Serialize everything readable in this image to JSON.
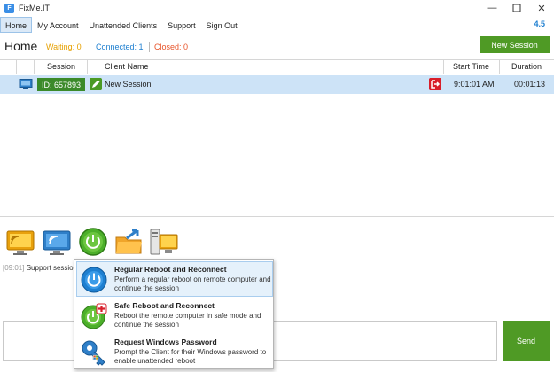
{
  "window": {
    "title": "FixMe.IT",
    "icon": "fixme-logo-icon",
    "controls": [
      "minimize-icon",
      "maximize-icon",
      "close-icon"
    ]
  },
  "menu": {
    "items": [
      "Home",
      "My Account",
      "Unattended Clients",
      "Support",
      "Sign Out"
    ],
    "active": "Home",
    "version": "4.5"
  },
  "status": {
    "page_title": "Home",
    "waiting": "Waiting: 0",
    "connected": "Connected: 1",
    "closed": "Closed: 0",
    "new_session_label": "New Session"
  },
  "colors": {
    "accent_green": "#4f9a25",
    "waiting": "#e6a000",
    "connected": "#1e7fd0",
    "closed": "#e8542a",
    "selected_row": "#cde3f7"
  },
  "table": {
    "headers": [
      "Session",
      "Client Name",
      "Start Time",
      "Duration"
    ],
    "rows": [
      {
        "icon": "monitor-icon",
        "session": "ID: 657893",
        "client_name": "New Session",
        "start_time": "9:01:01 AM",
        "duration": "00:01:13"
      }
    ]
  },
  "toolbar": {
    "tools": [
      "remote-desktop-icon",
      "wireless-monitor-icon",
      "power-reboot-icon",
      "file-transfer-icon",
      "system-info-icon"
    ]
  },
  "log": {
    "time": "[09:01]",
    "text": "Support sessio"
  },
  "chat": {
    "send_label": "Send"
  },
  "reboot_menu": {
    "items": [
      {
        "icon": "power-icon",
        "title": "Regular Reboot and Reconnect",
        "description": "Perform a regular reboot on remote computer and continue the session"
      },
      {
        "icon": "safe-reboot-icon",
        "title": "Safe Reboot and Reconnect",
        "description": "Reboot the remote computer in safe mode and continue the session"
      },
      {
        "icon": "windows-password-icon",
        "title": "Request Windows Password",
        "description": "Prompt the Client for their Windows password to enable unattended reboot"
      }
    ]
  }
}
